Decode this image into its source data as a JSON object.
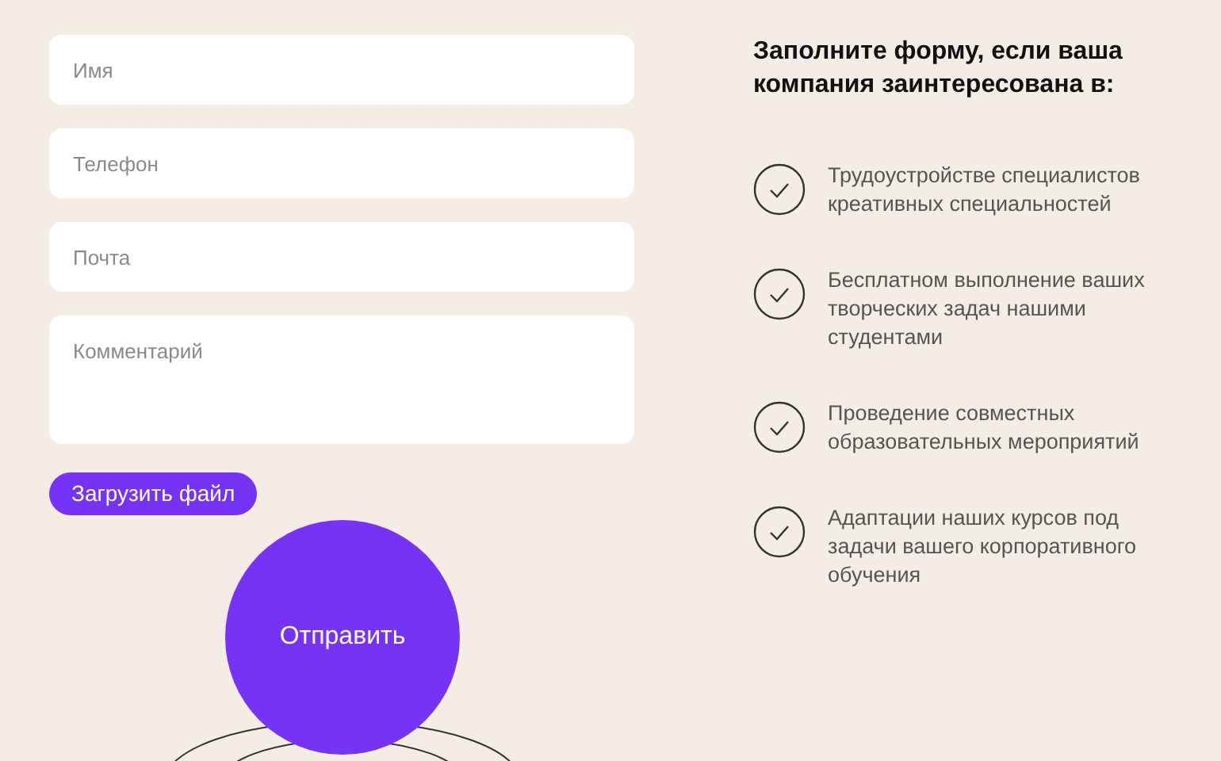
{
  "form": {
    "fields": [
      {
        "kind": "input",
        "placeholder": "Имя"
      },
      {
        "kind": "input",
        "placeholder": "Телефон"
      },
      {
        "kind": "input",
        "placeholder": "Почта"
      },
      {
        "kind": "textarea",
        "placeholder": "Комментарий"
      }
    ],
    "upload_button": "Загрузить файл",
    "submit_button": "Отправить"
  },
  "info": {
    "heading": "Заполните форму, если ваша компания заинтересована в:",
    "items": [
      "Трудоустройстве специалистов креативных специальностей",
      "Бесплатном выполнение ваших творческих задач нашими студентами",
      "Проведение совместных образовательных мероприятий",
      "Адаптации наших курсов под задачи вашего корпоративного обучения"
    ]
  }
}
